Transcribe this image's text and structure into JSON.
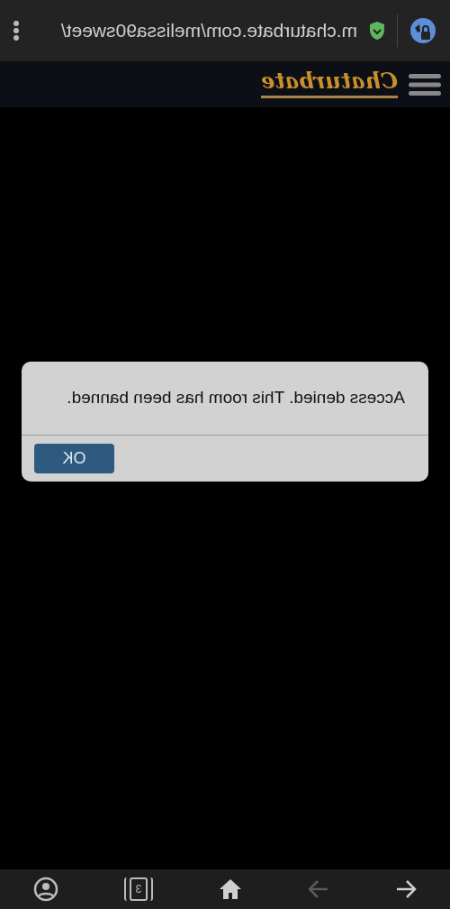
{
  "address_bar": {
    "url": "m.chaturbate.com/melissa90sweet/",
    "secure": true
  },
  "site_header": {
    "logo": "Chaturbate"
  },
  "dialog": {
    "message": "Access denied. This room has been banned.",
    "buttons": [
      "OK"
    ]
  },
  "bottom_bar": {
    "tab_count": "3",
    "back_enabled": true,
    "forward_enabled": false
  }
}
